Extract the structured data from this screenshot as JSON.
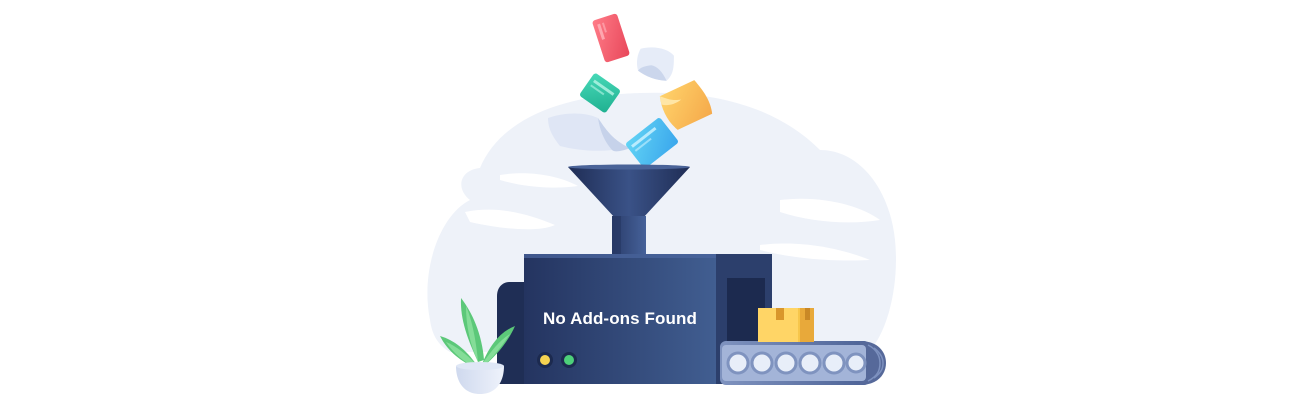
{
  "empty_state": {
    "message": "No Add-ons Found"
  },
  "icons": {
    "machine": "funnel-machine-illustration",
    "plant": "potted-plant-icon",
    "box": "cardboard-box-icon",
    "cards": [
      "red-card-icon",
      "green-card-icon",
      "blue-card-icon",
      "yellow-paper-icon",
      "white-paper-icon"
    ]
  },
  "colors": {
    "machine_dark": "#243460",
    "machine_light": "#3d5a8a",
    "background_cloud": "#eef2f9",
    "indicator_yellow": "#f5d351",
    "indicator_green": "#4dd07a",
    "box": "#f5c445",
    "plant": "#6ed08a"
  }
}
